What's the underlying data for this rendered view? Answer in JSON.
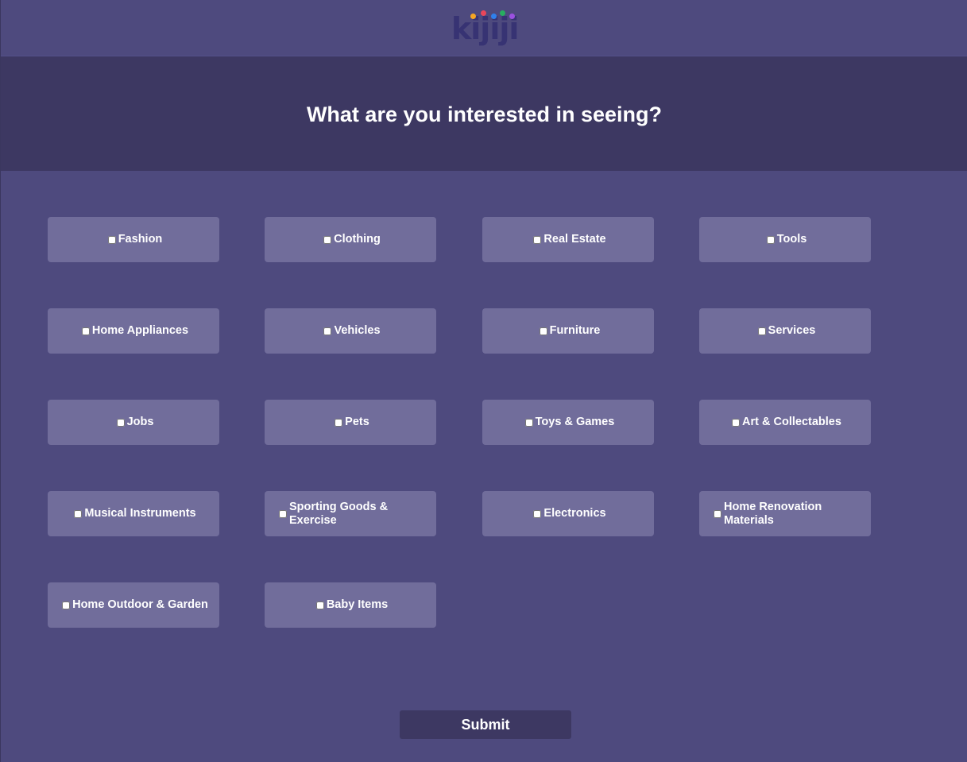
{
  "logo": {
    "text": "kijiji",
    "dot_colors": [
      "#f5a623",
      "#e8465a",
      "#2f80ed",
      "#27ae60",
      "#9b51e0"
    ]
  },
  "hero": {
    "title": "What are you interested in seeing?"
  },
  "options": [
    {
      "label": "Fashion",
      "checked": false
    },
    {
      "label": "Clothing",
      "checked": false
    },
    {
      "label": "Real Estate",
      "checked": false
    },
    {
      "label": "Tools",
      "checked": false
    },
    {
      "label": "Home Appliances",
      "checked": false
    },
    {
      "label": "Vehicles",
      "checked": false
    },
    {
      "label": "Furniture",
      "checked": false
    },
    {
      "label": "Services",
      "checked": false
    },
    {
      "label": "Jobs",
      "checked": false
    },
    {
      "label": "Pets",
      "checked": false
    },
    {
      "label": "Toys & Games",
      "checked": false
    },
    {
      "label": "Art & Collectables",
      "checked": false
    },
    {
      "label": "Musical Instruments",
      "checked": false
    },
    {
      "label": "Sporting Goods & Exercise",
      "checked": false
    },
    {
      "label": "Electronics",
      "checked": false
    },
    {
      "label": "Home Renovation Materials",
      "checked": false
    },
    {
      "label": "Home Outdoor & Garden",
      "checked": false
    },
    {
      "label": "Baby Items",
      "checked": false
    }
  ],
  "submit": {
    "label": "Submit"
  },
  "colors": {
    "background": "#4e4a7e",
    "hero": "#3d3862",
    "option": "#716d9b",
    "logo": "#373373"
  }
}
